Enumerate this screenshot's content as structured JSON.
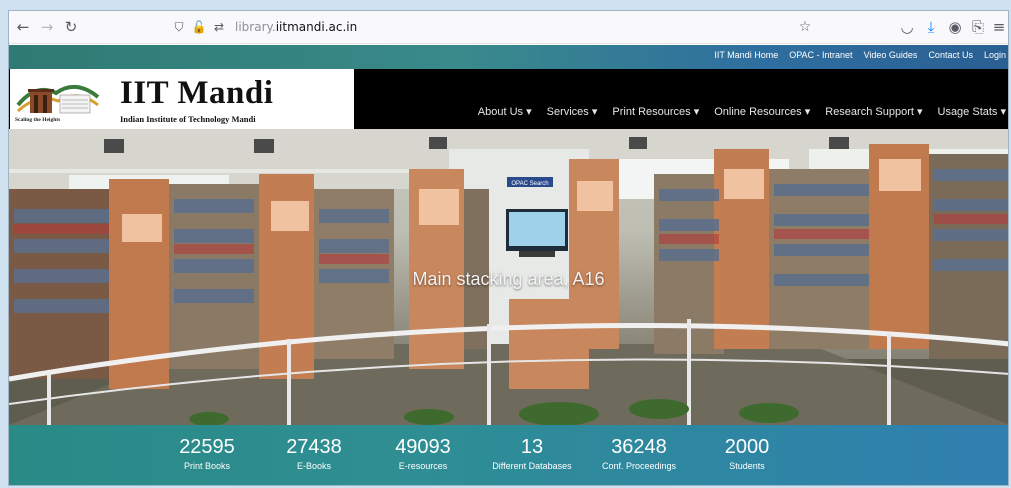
{
  "browser": {
    "url_subdomain": "library.",
    "url_domain": "iitmandi.ac.in"
  },
  "top_links": [
    "IIT Mandi Home",
    "OPAC - Intranet",
    "Video Guides",
    "Contact Us",
    "Login"
  ],
  "header": {
    "title": "IIT Mandi",
    "subtitle": "Indian Institute of Technology Mandi",
    "logo_tagline": "Scaling the Heights"
  },
  "nav": [
    {
      "label": "About Us ▾"
    },
    {
      "label": "Services ▾"
    },
    {
      "label": "Print Resources ▾"
    },
    {
      "label": "Online Resources ▾"
    },
    {
      "label": "Research Support ▾"
    },
    {
      "label": "Usage Stats ▾"
    }
  ],
  "hero": {
    "caption": "Main stacking area, A16",
    "monitor_sign": "OPAC Search"
  },
  "stats": [
    {
      "value": "22595",
      "label": "Print Books"
    },
    {
      "value": "27438",
      "label": "E-Books"
    },
    {
      "value": "49093",
      "label": "E-resources"
    },
    {
      "value": "13",
      "label": "Different Databases"
    },
    {
      "value": "36248",
      "label": "Conf. Proceedings"
    },
    {
      "value": "2000",
      "label": "Students"
    }
  ],
  "colors": {
    "header_bg": "#000000",
    "bar_teal": "#2f7a72",
    "bar_blue": "#2a5f92"
  }
}
